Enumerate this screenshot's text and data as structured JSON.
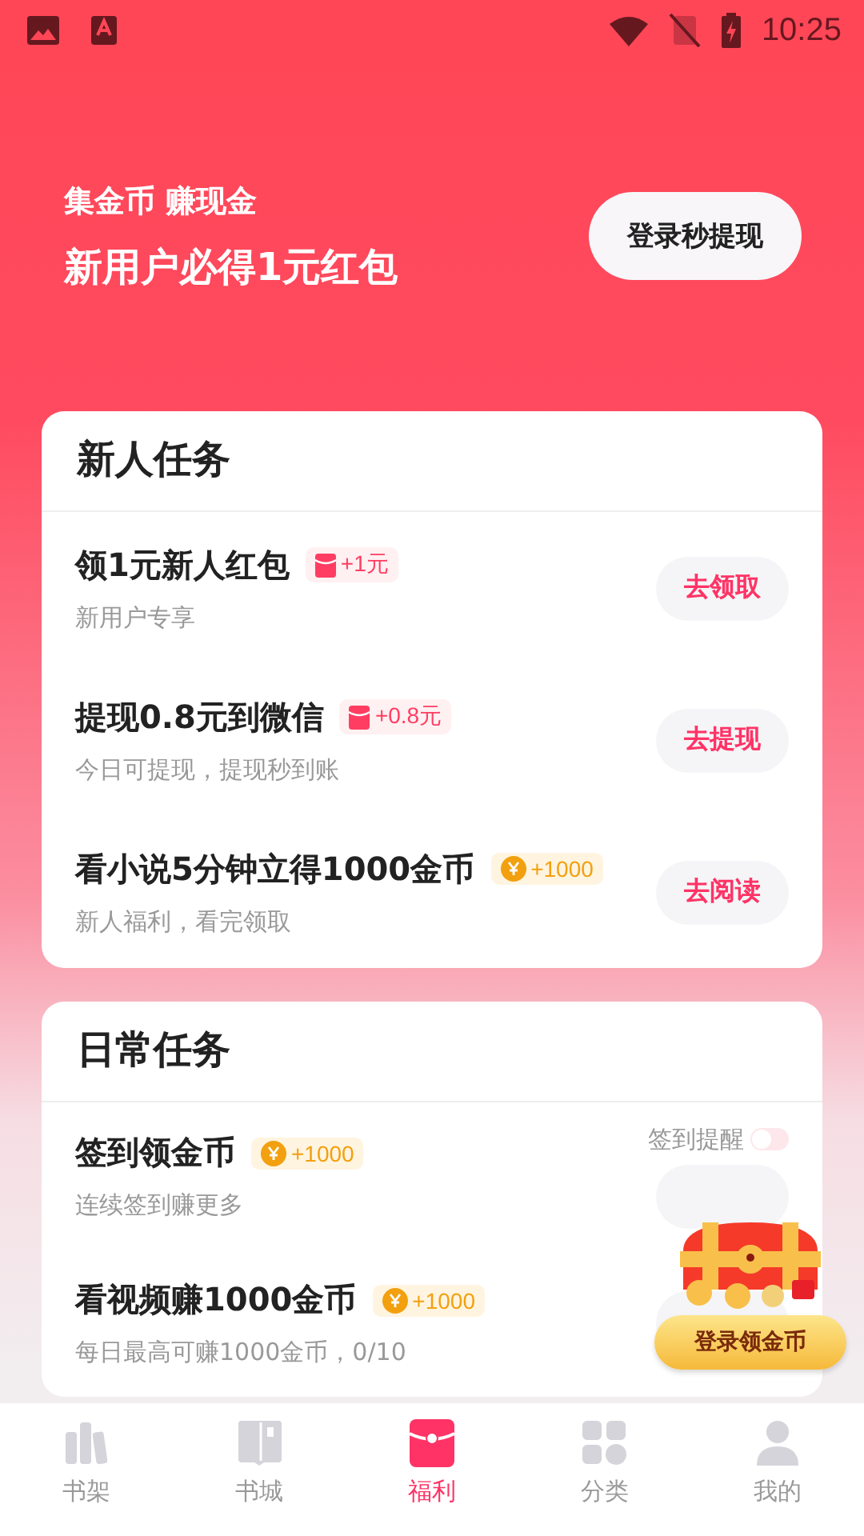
{
  "status_bar": {
    "time": "10:25"
  },
  "hero": {
    "subtitle": "集金币 赚现金",
    "title": "新用户必得1元红包",
    "button": "登录秒提现"
  },
  "sections": [
    {
      "title": "新人任务",
      "tasks": [
        {
          "title": "领1元新人红包",
          "reward": {
            "kind": "cash",
            "text": "+1元"
          },
          "desc": "新用户专享",
          "button": "去领取"
        },
        {
          "title": "提现0.8元到微信",
          "reward": {
            "kind": "cash",
            "text": "+0.8元"
          },
          "desc": "今日可提现，提现秒到账",
          "button": "去提现"
        },
        {
          "title": "看小说5分钟立得1000金币",
          "reward": {
            "kind": "coin",
            "text": "+1000"
          },
          "desc": "新人福利，看完领取",
          "button": "去阅读"
        }
      ]
    },
    {
      "title": "日常任务",
      "tasks": [
        {
          "title": "签到领金币",
          "reward": {
            "kind": "coin",
            "text": "+1000"
          },
          "desc": "连续签到赚更多",
          "reminder": {
            "label": "签到提醒",
            "on": false
          }
        },
        {
          "title": "看视频赚1000金币",
          "reward": {
            "kind": "coin",
            "text": "+1000"
          },
          "desc": "每日最高可赚1000金币，0/10"
        }
      ]
    }
  ],
  "floating": {
    "button": "登录领金币"
  },
  "nav": [
    {
      "label": "书架",
      "kind": "shelf",
      "selected": false
    },
    {
      "label": "书城",
      "kind": "book",
      "selected": false
    },
    {
      "label": "福利",
      "kind": "envelope",
      "selected": true
    },
    {
      "label": "分类",
      "kind": "grid",
      "selected": false
    },
    {
      "label": "我的",
      "kind": "person",
      "selected": false
    }
  ]
}
